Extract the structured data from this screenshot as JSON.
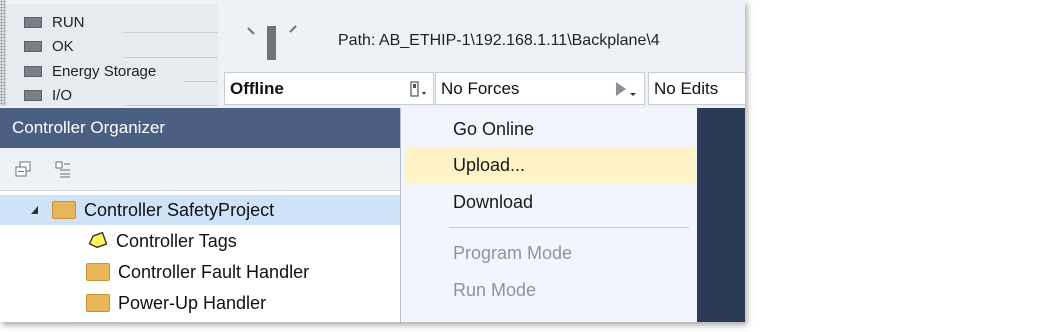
{
  "status_panel": {
    "rows": [
      {
        "label": "RUN"
      },
      {
        "label": "OK"
      },
      {
        "label": "Energy Storage"
      },
      {
        "label": "I/O"
      }
    ]
  },
  "path": {
    "label": "Path:",
    "value": "AB_ETHIP-1\\192.168.1.11\\Backplane\\4"
  },
  "status_bar": {
    "mode": "Offline",
    "forces": "No Forces",
    "edits": "No Edits"
  },
  "organizer": {
    "title": "Controller Organizer",
    "toolbar": [
      {
        "icon": "collapse-all-icon"
      },
      {
        "icon": "expand-all-icon"
      }
    ],
    "tree": [
      {
        "label": "Controller SafetyProject",
        "icon": "folder-icon"
      },
      {
        "label": "Controller Tags",
        "icon": "tag-icon"
      },
      {
        "label": "Controller Fault Handler",
        "icon": "folder-icon"
      },
      {
        "label": "Power-Up Handler",
        "icon": "folder-icon"
      }
    ]
  },
  "menu": {
    "items": [
      {
        "label": "Go Online",
        "enabled": true
      },
      {
        "label": "Upload...",
        "enabled": true,
        "highlighted": true
      },
      {
        "label": "Download",
        "enabled": true
      },
      {
        "label": "Program Mode",
        "enabled": false
      },
      {
        "label": "Run Mode",
        "enabled": false
      }
    ]
  },
  "colors": {
    "organizer_title_bg": "#4b5f82",
    "menu_hover_bg": "#fdf3c6",
    "selection_bg": "#cfe3f8",
    "folder": "#e8b55a"
  }
}
